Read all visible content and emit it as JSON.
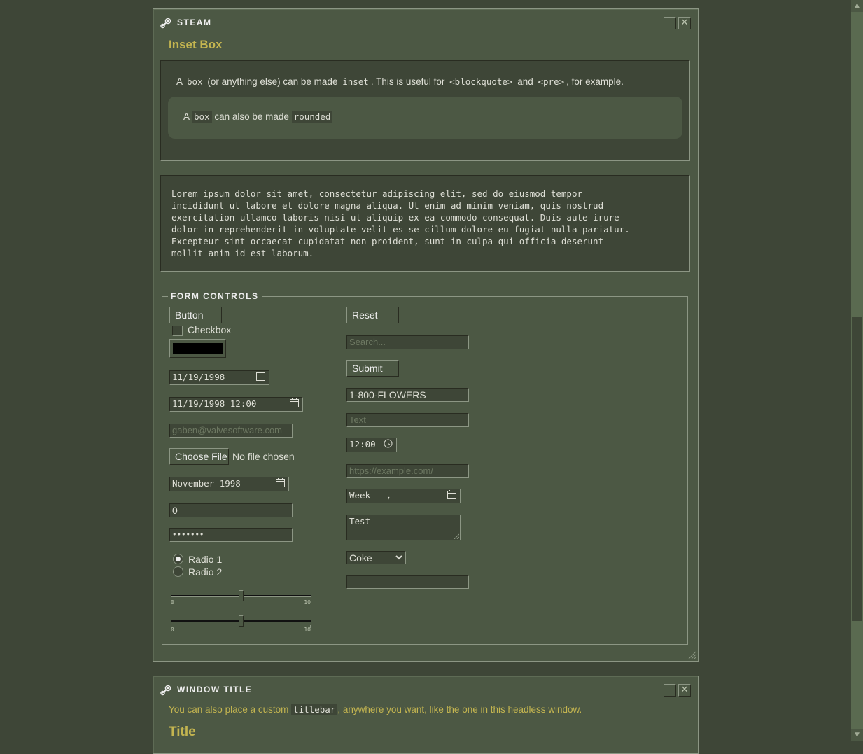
{
  "window1": {
    "title": "STEAM",
    "minimize": "_",
    "close": "✕",
    "heading": "Inset Box",
    "inset": {
      "line1": [
        "A ",
        "box",
        " (or anything else) can be made ",
        "inset",
        ". This is useful for ",
        "<blockquote>",
        " and ",
        "<pre>",
        ", for example."
      ],
      "rounded": [
        "A ",
        "box",
        " can also be made ",
        "rounded"
      ]
    },
    "pre": "Lorem ipsum dolor sit amet, consectetur adipiscing elit, sed do eiusmod tempor\nincididunt ut labore et dolore magna aliqua. Ut enim ad minim veniam, quis nostrud\nexercitation ullamco laboris nisi ut aliquip ex ea commodo consequat. Duis aute irure\ndolor in reprehenderit in voluptate velit es se cillum dolore eu fugiat nulla pariatur.\nExcepteur sint occaecat cupidatat non proident, sunt in culpa qui officia deserunt\nmollit anim id est laborum.",
    "form": {
      "legend": "FORM CONTROLS",
      "button": "Button",
      "checkbox_label": "Checkbox",
      "color_value": "#000000",
      "date": "11/19/1998",
      "datetime": "11/19/1998 12:00",
      "email_placeholder": "gaben@valvesoftware.com",
      "file_button": "Choose File",
      "file_status": "No file chosen",
      "month": "November 1998",
      "number": "0",
      "password": "•••••••",
      "radio1": "Radio 1",
      "radio2": "Radio 2",
      "range_min": "0",
      "range_max": "10",
      "range_value": 5,
      "reset": "Reset",
      "search_placeholder": "Search...",
      "submit": "Submit",
      "tel": "1-800-FLOWERS",
      "text_placeholder": "Text",
      "time": "12:00",
      "url_placeholder": "https://example.com/",
      "week": "Week --, ----",
      "textarea": "Test",
      "select": "Coke"
    }
  },
  "window2": {
    "title": "WINDOW TITLE",
    "minimize": "_",
    "close": "✕",
    "text": [
      "You can also place a custom ",
      "titlebar",
      ", anywhere you want, like the one in this headless window."
    ],
    "heading": "Title"
  },
  "scrollbar": {
    "up": "▲",
    "down": "▼"
  },
  "colors": {
    "bg": "#3e4637",
    "window": "#4c5844",
    "accent": "#c4b550",
    "border_light": "#8c9684",
    "border_dark": "#292c21"
  }
}
